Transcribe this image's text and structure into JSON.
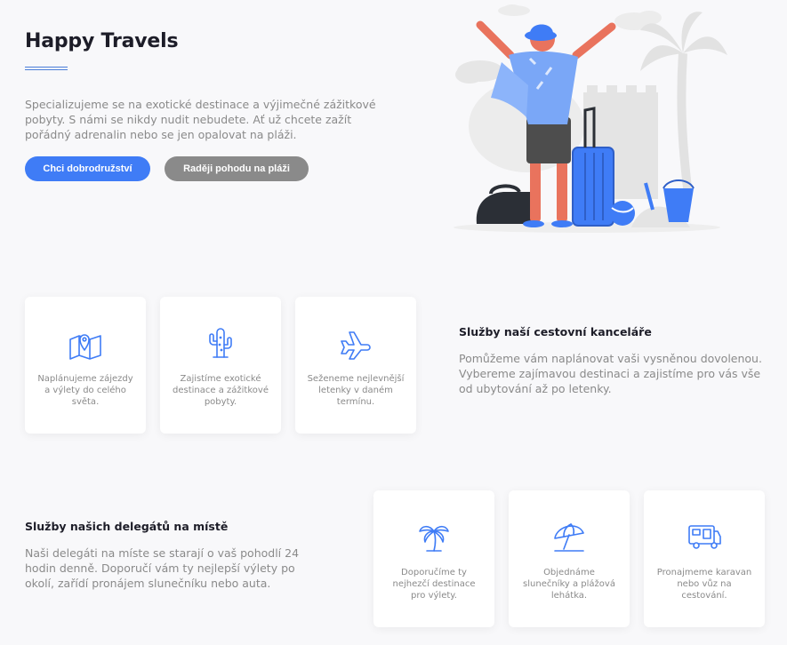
{
  "hero": {
    "title": "Happy Travels",
    "intro": "Specializujeme se na exotické destinace a výjimečné zážitkové pobyty. S námi se nikdy nudit nebudete. Ať už chcete zažít pořádný adrenalin nebo se jen opalovat na pláži.",
    "primary_button": "Chci dobrodružství",
    "secondary_button": "Raději pohodu na pláži"
  },
  "agency": {
    "title": "Služby naší cestovní kanceláře",
    "text": "Pomůžeme vám naplánovat vaši vysněnou dovolenou. Vybereme zajímavou destinaci a zajistíme pro vás vše od ubytování až po letenky.",
    "cards": [
      {
        "icon": "map-icon",
        "text": "Naplánujeme zájezdy a výlety do celého světa."
      },
      {
        "icon": "cactus-icon",
        "text": "Zajistíme exotické destinace a zážitkové pobyty."
      },
      {
        "icon": "airplane-icon",
        "text": "Seženeme nejlevnější letenky v daném termínu."
      }
    ]
  },
  "delegates": {
    "title": "Služby našich delegátů na místě",
    "text": "Naši delegáti na míste se starají o vaš pohodlí 24 hodin denně. Doporučí vám ty nejlepší výlety po okolí, zařídí pronájem slunečníku nebo auta.",
    "cards": [
      {
        "icon": "palm-tree-icon",
        "text": "Doporučíme ty nejhezčí destinace pro výlety."
      },
      {
        "icon": "beach-umbrella-icon",
        "text": "Objednáme slunečníky a plážová lehátka."
      },
      {
        "icon": "camper-van-icon",
        "text": "Pronajmeme karavan nebo vůz na cestování."
      }
    ]
  },
  "colors": {
    "accent": "#3f7cf6",
    "secondary": "#8a8a8a",
    "heading": "#1d1d28",
    "icon": "#3f7cf6"
  }
}
